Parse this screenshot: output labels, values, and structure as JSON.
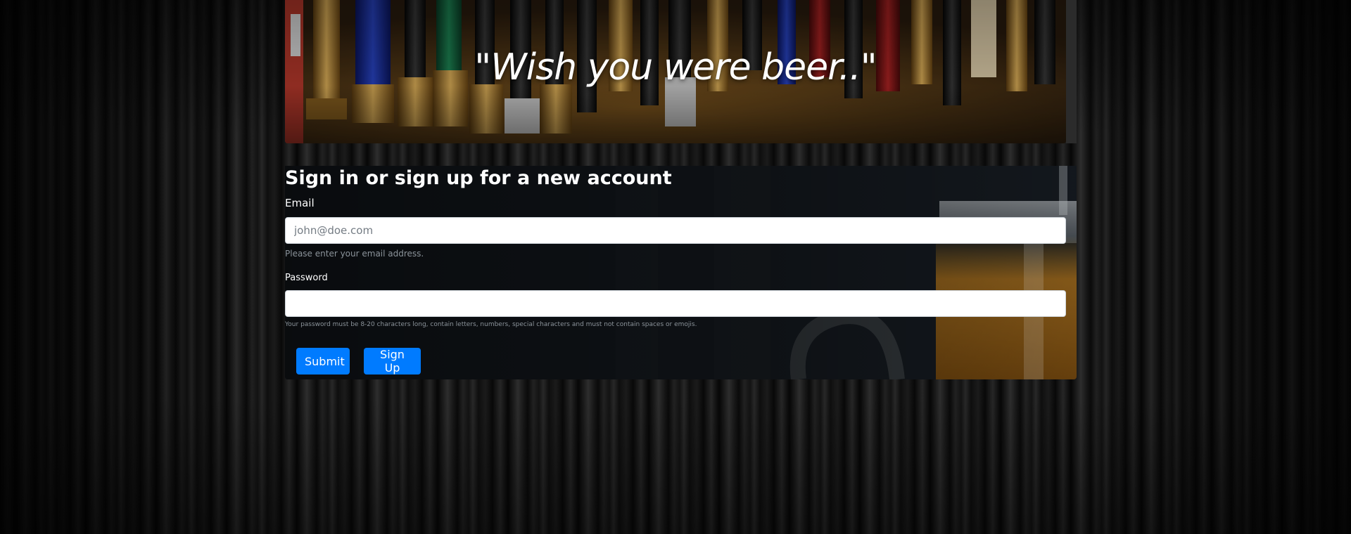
{
  "hero": {
    "quote": "\"Wish you were beer..\""
  },
  "form": {
    "title": "Sign in or sign up for a new account",
    "email": {
      "label": "Email",
      "placeholder": "john@doe.com",
      "value": "",
      "help": "Please enter your email address."
    },
    "password": {
      "label": "Password",
      "value": "",
      "help": "Your password must be 8-20 characters long, contain letters, numbers, special characters and must not contain spaces or emojis."
    },
    "submit_label": "Submit",
    "signup_label": "Sign Up"
  },
  "colors": {
    "button": "#007bff",
    "page_background": "#0c0c0c",
    "help_text": "#8b939a"
  }
}
